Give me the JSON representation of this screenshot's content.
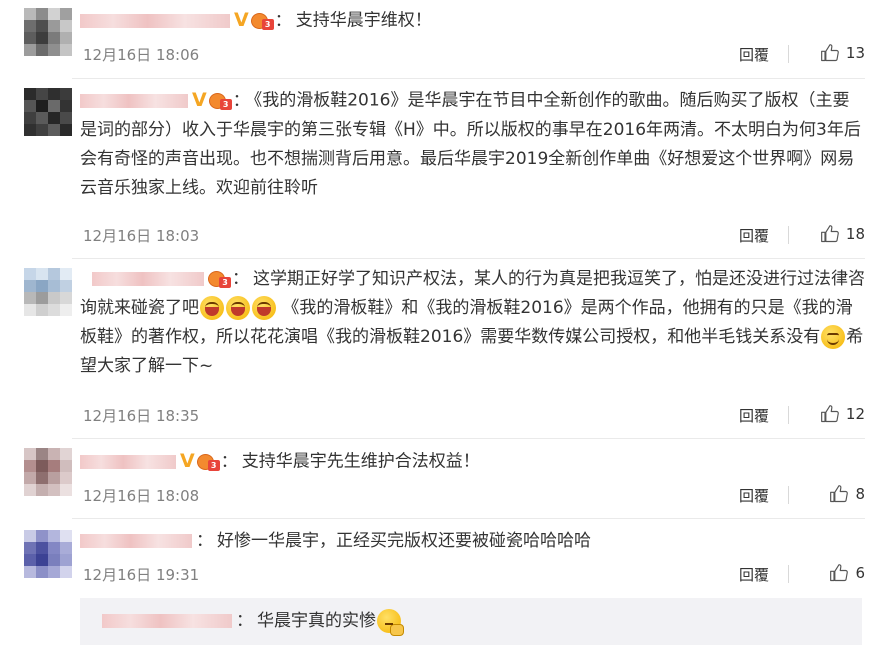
{
  "colors": {
    "accent": "#f5a623",
    "text": "#333333",
    "meta": "#808080"
  },
  "comments": [
    {
      "badge_v": "V",
      "colon": "：",
      "text": "支持华晨宇维权！",
      "time": "12月16日 18:06",
      "reply_label": "回覆",
      "likes": "13",
      "avatar": [
        "#b9b9b9",
        "#8c8c8c",
        "#d2d2d2",
        "#a0a0a0",
        "#6e6e6e",
        "#4f4f4f",
        "#9a9a9a",
        "#c8c8c8",
        "#5d5d5d",
        "#3d3d3d",
        "#7b7b7b",
        "#b0b0b0",
        "#9c9c9c",
        "#6b6b6b",
        "#8f8f8f",
        "#c4c4c4"
      ]
    },
    {
      "badge_v": "V",
      "colon": "：",
      "text": "《我的滑板鞋2016》是华晨宇在节目中全新创作的歌曲。随后购买了版权（主要是词的部分）收入于华晨宇的第三张专辑《H》中。所以版权的事早在2016年两清。不太明白为何3年后会有奇怪的声音出现。也不想揣测背后用意。最后华晨宇2019全新创作单曲《好想爱这个世界啊》网易云音乐独家上线。欢迎前往聆听",
      "time": "12月16日 18:03",
      "reply_label": "回覆",
      "likes": "18",
      "avatar": [
        "#2b2b2b",
        "#454545",
        "#2f2f2f",
        "#3b3b3b",
        "#555555",
        "#1e1e1e",
        "#6a6a6a",
        "#333333",
        "#3f3f3f",
        "#5a5a5a",
        "#262626",
        "#4a4a4a",
        "#303030",
        "#404040",
        "#5c5c5c",
        "#2a2a2a"
      ]
    },
    {
      "colon": "：",
      "text_part1": "这学期正好学了知识产权法，某人的行为真是把我逗笑了，怕是还没进行过法律咨询就来碰瓷了吧",
      "text_part2": " 《我的滑板鞋》和《我的滑板鞋2016》是两个作品，他拥有的只是《我的滑板鞋》的著作权，所以花花演唱《我的滑板鞋2016》需要华数传媒公司授权，和他半毛钱关系没有",
      "text_part3": "希望大家了解一下~",
      "emoji_laugh": "laugh-emoji",
      "emoji_smile": "smile-emoji",
      "time": "12月16日 18:35",
      "reply_label": "回覆",
      "likes": "12",
      "avatar": [
        "#c6d6e8",
        "#d8e4f0",
        "#b5c8dd",
        "#e2ebf4",
        "#9fb6cf",
        "#8aa6c4",
        "#a7bdd5",
        "#c0d0e2",
        "#b8b8b8",
        "#9c9c9c",
        "#c9c9c9",
        "#d8d8d8",
        "#e6e6e6",
        "#cfcfcf",
        "#dcdcdc",
        "#eeeeee"
      ]
    },
    {
      "badge_v": "V",
      "colon": "：",
      "text": "支持华晨宇先生维护合法权益！",
      "time": "12月16日 18:08",
      "reply_label": "回覆",
      "likes": "8",
      "avatar": [
        "#d7c6c6",
        "#9b8585",
        "#c9b3b3",
        "#e1d4d4",
        "#b38f8f",
        "#7d5b5b",
        "#a67d7d",
        "#d0bdbd",
        "#c2a9a9",
        "#8e6f6f",
        "#b99f9f",
        "#dccaca",
        "#e0d2d2",
        "#c4afaf",
        "#d3c0c0",
        "#ebe0e0"
      ]
    },
    {
      "colon": "：",
      "text": "好惨一华晨宇，正经买完版权还要被碰瓷哈哈哈哈",
      "time": "12月16日 19:31",
      "reply_label": "回覆",
      "likes": "6",
      "avatar": [
        "#c9cbe6",
        "#8f92c9",
        "#b3b6dd",
        "#dfe0f1",
        "#6f73b5",
        "#4d52a0",
        "#8387c4",
        "#a9acd8",
        "#5b60aa",
        "#3c4294",
        "#7a7fbd",
        "#9ea2d2",
        "#b7b9de",
        "#8b8fc7",
        "#a5a8d6",
        "#d2d3ec"
      ]
    }
  ],
  "sub_reply": {
    "colon": "：",
    "text": "华晨宇真的实惨",
    "emoji": "thinking-emoji"
  }
}
